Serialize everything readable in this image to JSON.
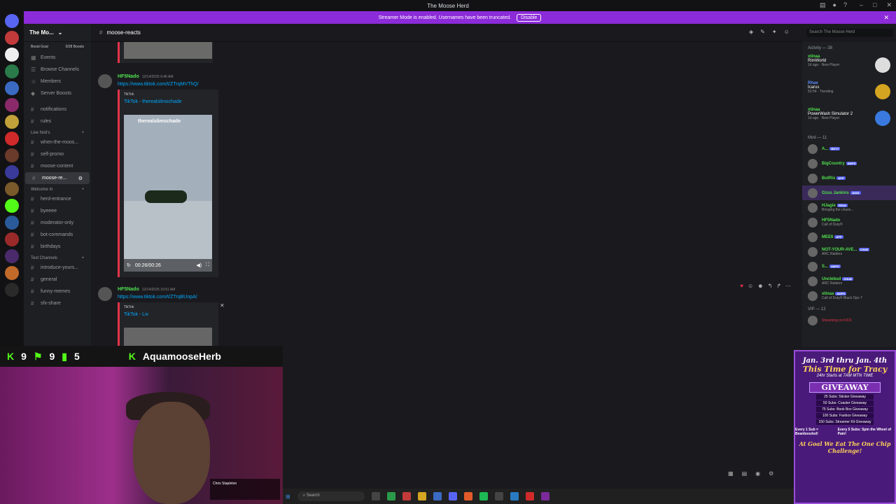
{
  "window": {
    "title": "The Moose Herd"
  },
  "banner": {
    "text": "Streamer Mode is enabled. Usernames have been truncated.",
    "disable_label": "Disable"
  },
  "guild": {
    "name": "The Mo...",
    "boost_goal": "Boost Goal",
    "boost_count": "0/28 Boosts"
  },
  "channels": {
    "top": [
      "Events",
      "Browse Channels",
      "Members",
      "Server Boosts"
    ],
    "misc": [
      "notifications",
      "rules"
    ],
    "cat_live": "Live Noti's",
    "live": [
      "when-the-moos...",
      "self-promo",
      "moose-content",
      "moose-re..."
    ],
    "cat_welcome": "Welcome In",
    "welcome": [
      "herd-entrance",
      "byeeee",
      "moderator-only",
      "bot-commands",
      "birthdays"
    ],
    "cat_text": "Text Channels",
    "text": [
      "introduce-yours...",
      "general",
      "funny-memes",
      "sfx-share"
    ]
  },
  "header": {
    "channel": "moose-reacts",
    "search_placeholder": "Search The Moose Herd"
  },
  "messages": [
    {
      "author": "HF5Nado",
      "time": "12/14/2025 9:46 AM",
      "link": "https://www.tiktok.com/t/ZTrqMVThQ/",
      "provider": "TikTok",
      "embed_title": "TikTok - therealslimschade",
      "video_handle": "therealslimschade",
      "video_time": "00:26/00:26"
    },
    {
      "author": "HF5Nado",
      "time": "12/14/2025 10:51 AM",
      "link": "https://www.tiktok.com/t/ZTrqBUnpA/",
      "provider": "TikTok",
      "embed_title": "TikTok - Liv"
    }
  ],
  "members_panel": {
    "activity_header": "Activity — 38",
    "activities": [
      {
        "name": "xtinaa",
        "game": "RimWorld",
        "meta": "1d ago",
        "status": "New Player"
      },
      {
        "name": "Rhae",
        "game": "Icarus",
        "meta": "52:54",
        "status": "Trending"
      },
      {
        "name": "xtinaa",
        "game": "PowerWash Simulator 2",
        "meta": "1d ago",
        "status": "New Player"
      }
    ],
    "mod_header": "Mod — 11",
    "mods": [
      {
        "name": "A...",
        "tag": "BNTY",
        "color": "#4fe14f",
        "sub": ""
      },
      {
        "name": "BigCountry",
        "tag": "AWPS",
        "color": "#4fe14f",
        "sub": ""
      },
      {
        "name": "BotRix",
        "tag": "APP",
        "color": "#4fe14f",
        "sub": ""
      },
      {
        "name": "Gzus Jankins",
        "tag": "JANK",
        "color": "#4fe14f",
        "sub": ""
      },
      {
        "name": "HJagie",
        "tag": "FRSH",
        "color": "#4fe14f",
        "sub": "Bringing the chaos..."
      },
      {
        "name": "HF5Nado",
        "tag": "",
        "color": "#4fe14f",
        "sub": "Call of Duty®"
      },
      {
        "name": "MEE6",
        "tag": "APP",
        "color": "#4fe14f",
        "sub": ""
      },
      {
        "name": "NOT-YOUR-AVE...",
        "tag": "CHUB",
        "color": "#4fe14f",
        "sub": "ARC Raiders"
      },
      {
        "name": "S...",
        "tag": "AWPS",
        "color": "#4fe14f",
        "sub": ""
      },
      {
        "name": "Unclebud",
        "tag": "CHUB",
        "color": "#4fe14f",
        "sub": "ARC Raiders"
      },
      {
        "name": "xtinaa",
        "tag": "AWPS",
        "color": "#4fe14f",
        "sub": "Call of Duty® Black Ops 7"
      }
    ],
    "vip_header": "VIP — 12",
    "vip_sub": "Streaming on KICK"
  },
  "stream": {
    "followers": "9",
    "subs": "9",
    "viewers": "5",
    "streamer": "AquamooseHerb",
    "song_artist": "Chris Stapleton"
  },
  "taskbar": {
    "search": "Search"
  },
  "promo": {
    "dates": "Jan. 3rd thru Jan. 4th",
    "subtitle": "This Time for Tracy",
    "start": "24hr Starts at 7AM MTN TIME",
    "giveaway": "GIVEAWAY",
    "tiers": [
      "25 Subs: Sticker Giveaway",
      "50 Subs: Coaster Giveaway",
      "75 Subs: Book Box Giveaway",
      "100 Subs: Fanbox Giveaway",
      "150 Subs: Streamer Kit Giveaway"
    ],
    "left_bottom": "Every 1 Sub = Beanboozled!",
    "right_bottom": "Every 5 Subs: Spin the Wheel of Pain!",
    "goal": "At Goal We Eat The One Chip Challenge!"
  }
}
